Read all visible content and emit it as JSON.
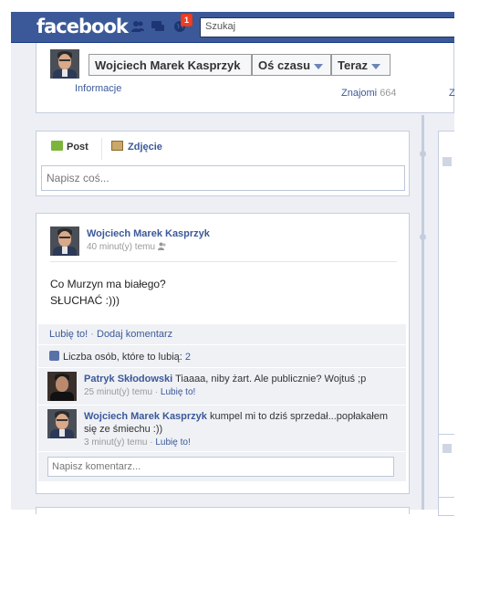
{
  "topbar": {
    "logo": "facebook",
    "notification_count": "1",
    "search_placeholder": "Szukaj"
  },
  "header": {
    "name_button": "Wojciech Marek Kasprzyk",
    "timeline_button": "Oś czasu",
    "now_button": "Teraz",
    "info_link": "Informacje",
    "friends_label": "Znajomi",
    "friends_count": "664",
    "cut_tab": "Z"
  },
  "composer": {
    "tab_post": "Post",
    "tab_photo": "Zdjęcie",
    "placeholder": "Napisz coś..."
  },
  "post": {
    "author": "Wojciech Marek Kasprzyk",
    "time": "40 minut(y) temu",
    "line1": "Co Murzyn ma białego?",
    "line2": "SŁUCHAĆ :)))",
    "like_action": "Lubię to!",
    "comment_action": "Dodaj komentarz",
    "likes_label": "Liczba osób, które to lubią:",
    "likes_count": "2",
    "reply_placeholder": "Napisz komentarz...",
    "comments": [
      {
        "author": "Patryk Skłodowski",
        "text": "Tiaaaa, niby żart. Ale publicznie? Wojtuś ;p",
        "time": "25 minut(y) temu",
        "like": "Lubię to!"
      },
      {
        "author": "Wojciech Marek Kasprzyk",
        "text": "kumpel mi to dziś sprzedał...popłakałem się ze śmiechu :))",
        "time": "3 minut(y) temu",
        "like": "Lubię to!"
      }
    ]
  },
  "colors": {
    "brand_blue": "#3b5998",
    "link_blue": "#3b5998",
    "page_grey": "#e9ebee",
    "ufi_bg": "#eff1f5"
  }
}
